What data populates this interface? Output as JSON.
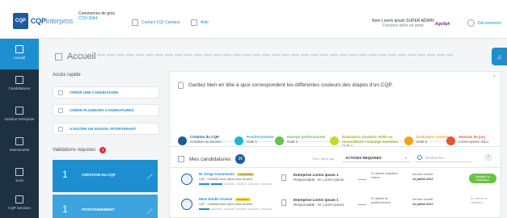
{
  "header": {
    "logo_icon": "CQP",
    "logo_brand": "CQP",
    "logo_suffix": "interpros",
    "org_name": "Commerces de gros",
    "org_sub": "CCN 3044",
    "link_contact": "Contact CQI Campus",
    "link_help": "Aide",
    "user_name": "Nom Lorem ipsum SUPER ADMIN",
    "user_role": "Fonction dolor sit amet",
    "brand_logo": "Agefiph",
    "logout": "Déconnexion"
  },
  "sidebar": {
    "items": [
      {
        "label": "Accueil",
        "icon": "home-icon",
        "active": true
      },
      {
        "label": "Candidatures",
        "icon": "folder-icon",
        "active": false
      },
      {
        "label": "Gestion entreprise",
        "icon": "briefcase-icon",
        "active": false
      },
      {
        "label": "Intervenants",
        "icon": "user-icon",
        "active": false
      },
      {
        "label": "Suivi",
        "icon": "graduation-icon",
        "active": false
      },
      {
        "label": "CQP services",
        "icon": "services-icon",
        "active": false
      }
    ]
  },
  "main": {
    "title": "Accueil",
    "quick_access": {
      "title": "Accès rapide",
      "items": [
        {
          "label": "CRÉER UNE CANDIDATURE"
        },
        {
          "label": "CRÉER PLUSIEURS CANDIDATURES"
        },
        {
          "label": "AJOUTER UN NOUVEL INTERVENANT"
        }
      ]
    },
    "validations": {
      "title": "Validations requises",
      "count": "1",
      "cards": [
        {
          "num": "1",
          "label": "CRÉATION DU CQP"
        },
        {
          "num": "1",
          "label": "POSITIONNEMENT"
        }
      ]
    },
    "legend": {
      "intro": "Gardez bien en tête à quoi correspondent les différentes couleurs des étapes d'un CQP.",
      "close": "×",
      "steps": [
        {
          "title": "Création du CQP",
          "desc": "Création du dossier",
          "color": "#1d5aa0"
        },
        {
          "title": "Positionnement",
          "desc": "Outil 1",
          "color": "#1db8d6"
        },
        {
          "title": "Devenir professionnel",
          "desc": "Outil 2",
          "color": "#6ac145"
        },
        {
          "title": "Évaluation situation réelle ou reconstituée / échange entretien",
          "desc": "Outil 4",
          "color": "#c5d82d"
        },
        {
          "title": "Évaluation externe",
          "desc": "Outil 5",
          "color": "#f2a31b"
        },
        {
          "title": "Session de jury",
          "desc": "Lorem ipsum dolor",
          "color": "#e8542c"
        }
      ]
    },
    "candidatures": {
      "title": "Mes candidatures",
      "count": "26",
      "filter_label": "Trier / filtrer par",
      "filter_value": "ACTIONS REQUISES",
      "search_placeholder": "Rechercher...",
      "rows": [
        {
          "name": "M. Serge Karamazov",
          "tag": "VALIDATION",
          "contract": "CQP : Certificat lorem ipsum dolor sit amet",
          "company": "Entreprise Lorem ipsum 1",
          "manager": "Responsable : M. Lorem Ipsum",
          "eval": "En attente évaluation interne",
          "last_label": "Dernière activité :",
          "last_date": "12 juillet 2017",
          "action": "Désigner un évaluateur"
        },
        {
          "name": "Mme Emilie Gravier",
          "tag": "NOUVEAU",
          "contract": "CQP : Certificat lorem ipsum dolor sit amet",
          "company": "Entreprise Lorem ipsum 1",
          "manager": "Responsable : M. Lorem ipsum",
          "eval": "En attente de positionnement",
          "last_label": "Dernière activité :",
          "last_date": "12 juillet 2017",
          "action": "En attente de validation"
        }
      ]
    }
  }
}
